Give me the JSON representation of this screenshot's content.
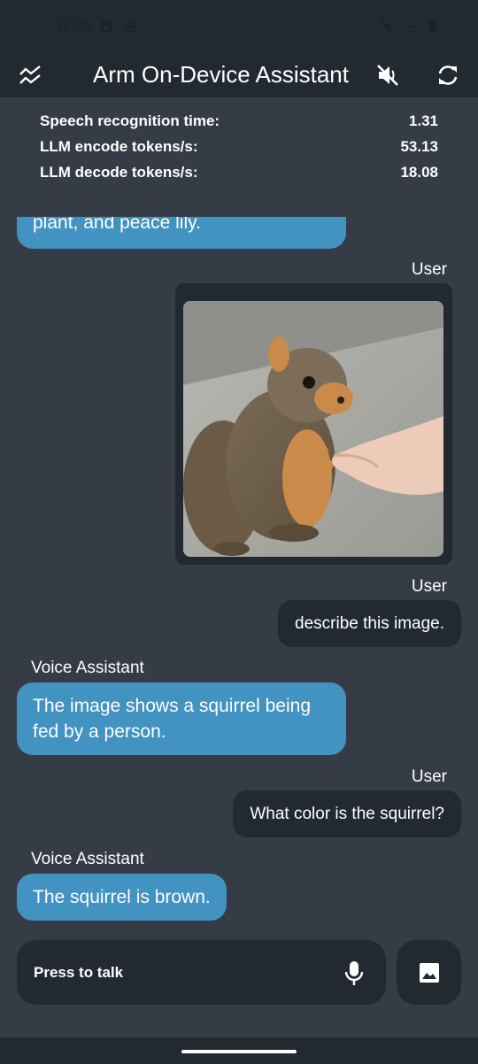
{
  "status_bar": {
    "time": "11:00",
    "left_icons": [
      "android-head-icon",
      "gear-icon"
    ],
    "right_icons": [
      "mute-icon",
      "airplane-icon",
      "battery-icon"
    ]
  },
  "app_bar": {
    "title": "Arm On-Device Assistant",
    "left_icon": "trend-chart-icon",
    "right_icons": [
      "speaker-muted-icon",
      "refresh-icon"
    ]
  },
  "stats": [
    {
      "label": "Speech recognition time:",
      "value": "1.31"
    },
    {
      "label": "LLM encode tokens/s:",
      "value": "53.13"
    },
    {
      "label": "LLM decode tokens/s:",
      "value": "18.08"
    }
  ],
  "chat": {
    "partial_ai_message": "plant, and peace lily.",
    "user_label": "User",
    "assistant_label": "Voice Assistant",
    "image_alt": "squirrel being fed by a hand",
    "messages": [
      {
        "role": "user",
        "text": "describe this image."
      },
      {
        "role": "assistant",
        "text": "The image shows a squirrel being fed by a person."
      },
      {
        "role": "user",
        "text": "What color is the squirrel?"
      },
      {
        "role": "assistant",
        "text": "The squirrel is brown."
      }
    ]
  },
  "input": {
    "press_to_talk": "Press to talk",
    "mic_icon": "microphone-icon",
    "image_icon": "image-icon"
  },
  "colors": {
    "background": "#353c46",
    "bar": "#232931",
    "assistant_bubble": "#4292c2",
    "user_bubble": "#232931"
  }
}
